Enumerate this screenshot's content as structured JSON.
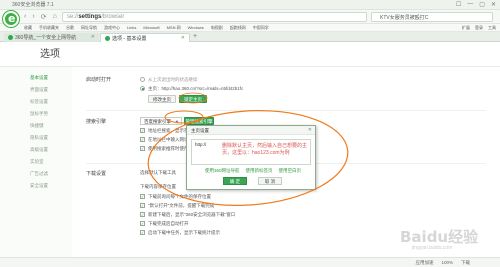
{
  "window": {
    "title": "360安全浏览器 7.1",
    "controls": [
      "☐",
      "—",
      "▢",
      "✕"
    ]
  },
  "address_bar": {
    "scheme": "se://",
    "host": "settings",
    "path": "/browser",
    "search_query": "KTV女服务员被殴打C",
    "nav": [
      "‹",
      "›",
      "⟳",
      "⌂"
    ]
  },
  "bookmarks": {
    "items": [
      "收藏",
      "手机收藏夹",
      "谷歌",
      "网址导航",
      "游戏中心",
      "Links",
      "Microsoft",
      "MSN 网",
      "Windows",
      "电视剧",
      "起跑线网",
      "中国同学"
    ],
    "right": [
      "扩展",
      "登录",
      "工具"
    ]
  },
  "tabs": [
    {
      "label": "360导航_一个安全上网导航",
      "close": "✕"
    },
    {
      "label": "选项 - 基本设置",
      "close": "✕"
    }
  ],
  "tab_add": "+",
  "page": {
    "title": "选项"
  },
  "sidebar": {
    "items": [
      {
        "label": "基本设置",
        "active": true
      },
      {
        "label": "界面设置",
        "active": false
      },
      {
        "label": "标签设置",
        "active": false
      },
      {
        "label": "鼠标手势",
        "active": false
      },
      {
        "label": "快捷键",
        "active": false
      },
      {
        "label": "隐私设置",
        "active": false
      },
      {
        "label": "高级设置",
        "active": false
      },
      {
        "label": "实验室",
        "active": false
      },
      {
        "label": "广告过滤",
        "active": false
      },
      {
        "label": "安全设置",
        "active": false
      }
    ]
  },
  "startup": {
    "label": "启动时打开",
    "option1": "从上次退出时的状态继续",
    "option2": "主页：http://hao.360.cn/?src=lm&ls=n5fd42b1fc",
    "modify_button": "修改主页",
    "lock_button": "锁定主页"
  },
  "search": {
    "label": "搜索引擎",
    "select_value": "百度搜索引擎",
    "manage_button": "管理搜索引擎",
    "options": [
      {
        "label": "地址栏搜索，显示在首页",
        "checked": true
      },
      {
        "label": "在地址栏中输入网址时显示搜索建议",
        "checked": true
      },
      {
        "label": "使用搜索推荐时使用用户搜索记录",
        "checked": true
      }
    ]
  },
  "download": {
    "label": "下载设置",
    "tool": "选择默认下载工具",
    "save_path_label": "下载内容保存位置",
    "options": [
      {
        "label": "下载前询问每个文件的保存位置",
        "checked": true
      },
      {
        "label": "\"默认打开\"文件前，提醒下载完成",
        "checked": true
      },
      {
        "label": "新建下载后，显示\"360安全浏览器下载\"窗口",
        "checked": true
      },
      {
        "label": "下载完成后自动打开",
        "checked": true
      },
      {
        "label": "启动下载中任务，显示下载统计提示",
        "checked": true
      }
    ]
  },
  "dialog": {
    "title": "主页设置",
    "close": "✕",
    "textarea_value": "http://",
    "message": "删除默认主页，然后输入自己想要的主页，这里以：hao123.com为例",
    "links": [
      "使用360网址导航",
      "使用新标签页",
      "使用空白页"
    ],
    "ok_button": "确 定",
    "cancel_button": "取 消"
  },
  "statusbar": {
    "right": [
      "应用加速",
      "100%",
      "下载"
    ]
  },
  "watermark": "Baidu经验",
  "watermark_sub": "jingyan.baidu.com",
  "colors": {
    "accent_green": "#3aa655",
    "annotation_orange": "#f07a1a",
    "message_red": "#d9534f"
  }
}
